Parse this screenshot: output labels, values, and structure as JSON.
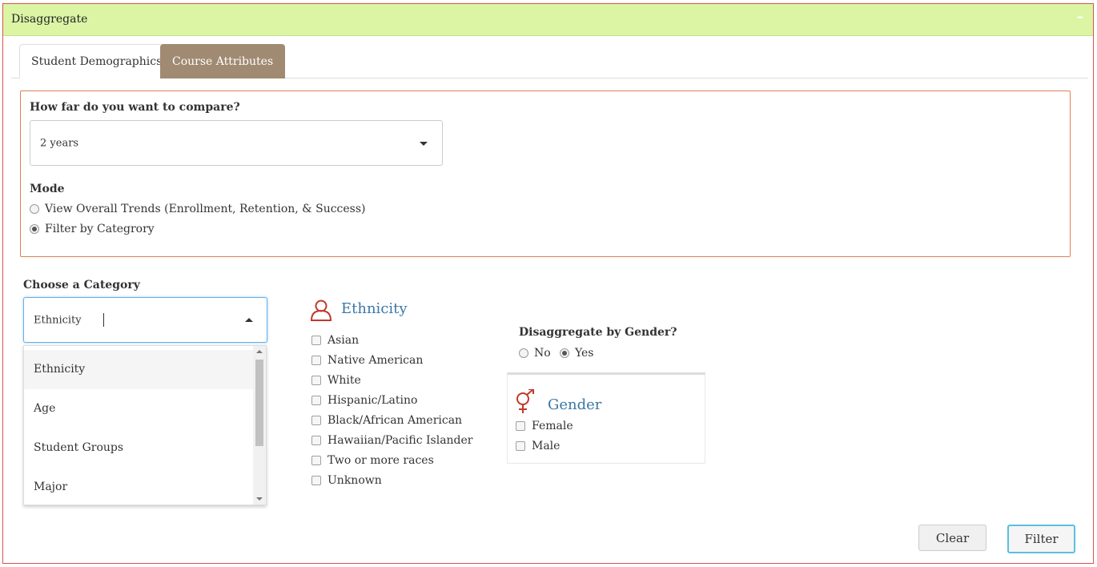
{
  "panel": {
    "title": "Disaggregate",
    "collapse_symbol": "–"
  },
  "tabs": [
    {
      "label": "Student Demographics",
      "active": true
    },
    {
      "label": "Course Attributes",
      "active": false
    }
  ],
  "compare": {
    "label": "How far do you want to compare?",
    "selected": "2 years"
  },
  "mode": {
    "label": "Mode",
    "options": [
      {
        "label": "View Overall Trends (Enrollment, Retention, & Success)",
        "checked": false
      },
      {
        "label": "Filter by Categrory",
        "checked": true
      }
    ]
  },
  "category": {
    "label": "Choose a Category",
    "input_value": "Ethnicity",
    "options": [
      "Ethnicity",
      "Age",
      "Student Groups",
      "Major"
    ],
    "highlighted_index": 0
  },
  "ethnicity": {
    "title": "Ethnicity",
    "icon": "person-outline-icon",
    "options": [
      "Asian",
      "Native American",
      "White",
      "Hispanic/Latino",
      "Black/African American",
      "Hawaiian/Pacific Islander",
      "Two or more races",
      "Unknown"
    ]
  },
  "gender_toggle": {
    "label": "Disaggregate by Gender?",
    "options": [
      {
        "label": "No",
        "checked": false
      },
      {
        "label": "Yes",
        "checked": true
      }
    ]
  },
  "gender": {
    "title": "Gender",
    "icon": "gender-symbol-icon",
    "options": [
      "Female",
      "Male"
    ]
  },
  "buttons": {
    "clear": "Clear",
    "filter": "Filter"
  },
  "colors": {
    "header_bg": "#dbf5a5",
    "panel_border": "#d9534f",
    "inactive_tab": "#a08a72",
    "section_title": "#3a78a8",
    "icon_red": "#c0392b",
    "filter_border": "#5bc0de"
  }
}
